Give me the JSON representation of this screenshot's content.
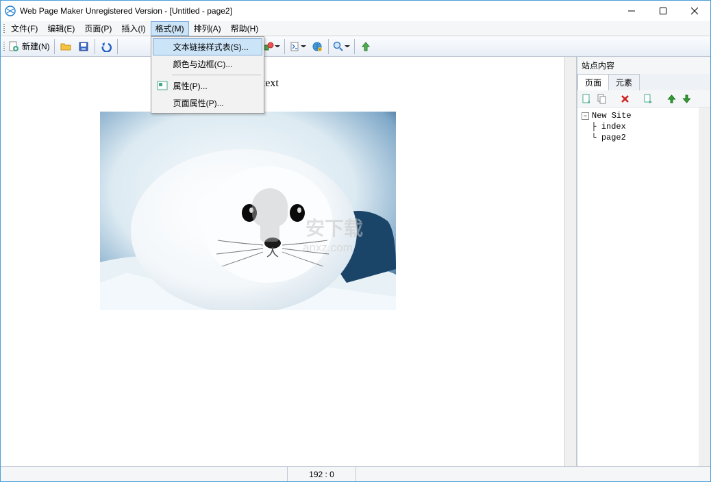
{
  "window": {
    "title": "Web Page Maker Unregistered Version - [Untitled - page2]"
  },
  "menubar": {
    "file": "文件(F)",
    "edit": "编辑(E)",
    "page": "页面(P)",
    "insert": "插入(I)",
    "format": "格式(M)",
    "arrange": "排列(A)",
    "help": "帮助(H)"
  },
  "format_menu": {
    "text_link_style": "文本链接样式表(S)...",
    "color_border": "颜色与边框(C)...",
    "properties": "属性(P)...",
    "page_properties": "页面属性(P)..."
  },
  "toolbar": {
    "new_label": "新建(N)"
  },
  "canvas": {
    "text_fragment": "‹ to edit text"
  },
  "sidepanel": {
    "title": "站点内容",
    "tab_page": "页面",
    "tab_element": "元素",
    "tree_root": "New Site",
    "tree_item1": "index",
    "tree_item2": "page2"
  },
  "statusbar": {
    "coords": "192 : 0"
  },
  "watermark": {
    "line1": "安下载",
    "line2": "anxz.com"
  }
}
